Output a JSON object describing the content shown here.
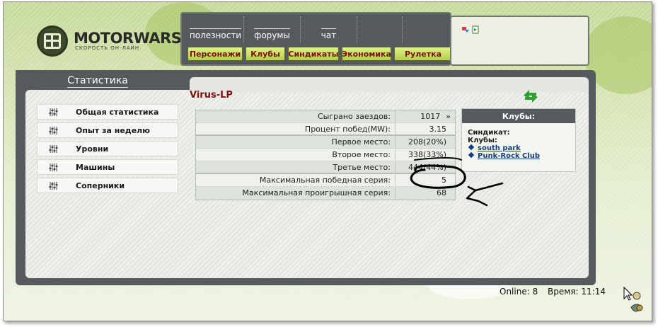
{
  "brand": {
    "title": "MOTORWARS.RU",
    "subtitle": "СКОРОСТЬ ОН-ЛАЙН"
  },
  "top_nav": {
    "links": [
      "полезности",
      "форумы",
      "чат"
    ],
    "buttons": [
      "Персонажи",
      "Клубы",
      "Синдикаты",
      "Экономика",
      "Рулетка"
    ]
  },
  "section": {
    "tab_title": "Статистика",
    "player_name": "Virus-LP"
  },
  "sidebar": {
    "items": [
      {
        "label": "Общая статистика"
      },
      {
        "label": "Опыт за неделю"
      },
      {
        "label": "Уровни"
      },
      {
        "label": "Машины"
      },
      {
        "label": "Соперники"
      }
    ]
  },
  "stats": {
    "rows": [
      {
        "label": "Сыграно заездов:",
        "value": "1017",
        "extra": "»"
      },
      {
        "label": "Процент побед(MW):",
        "value": "3.15"
      },
      {
        "label": "Первое место:",
        "value": "208(20%)"
      },
      {
        "label": "Второе место:",
        "value": "338(33%)"
      },
      {
        "label": "Третье место:",
        "value": "444(44%)"
      },
      {
        "label": "Максимальная победная серия:",
        "value": "5"
      },
      {
        "label": "Максимальная проигрышная серия:",
        "value": "68"
      }
    ]
  },
  "clubs": {
    "header": "Клубы:",
    "syndicate_label": "Синдикат:",
    "clubs_label": "Клубы:",
    "items": [
      "south park",
      "Punk-Rock Club"
    ]
  },
  "status": {
    "online_label": "Online:",
    "online_value": "8",
    "time_label": "Время:",
    "time_value": "11:14"
  },
  "icons": {
    "refresh": "refresh-arrows-icon",
    "settings": "sliders-icon",
    "cursor": "character-cursor-icon"
  },
  "colors": {
    "panel_dark": "#545a5e",
    "button_green": "#c5dd5e",
    "button_text": "#7a1010",
    "link_blue": "#143e7e",
    "page_green": "#c6d99a"
  }
}
